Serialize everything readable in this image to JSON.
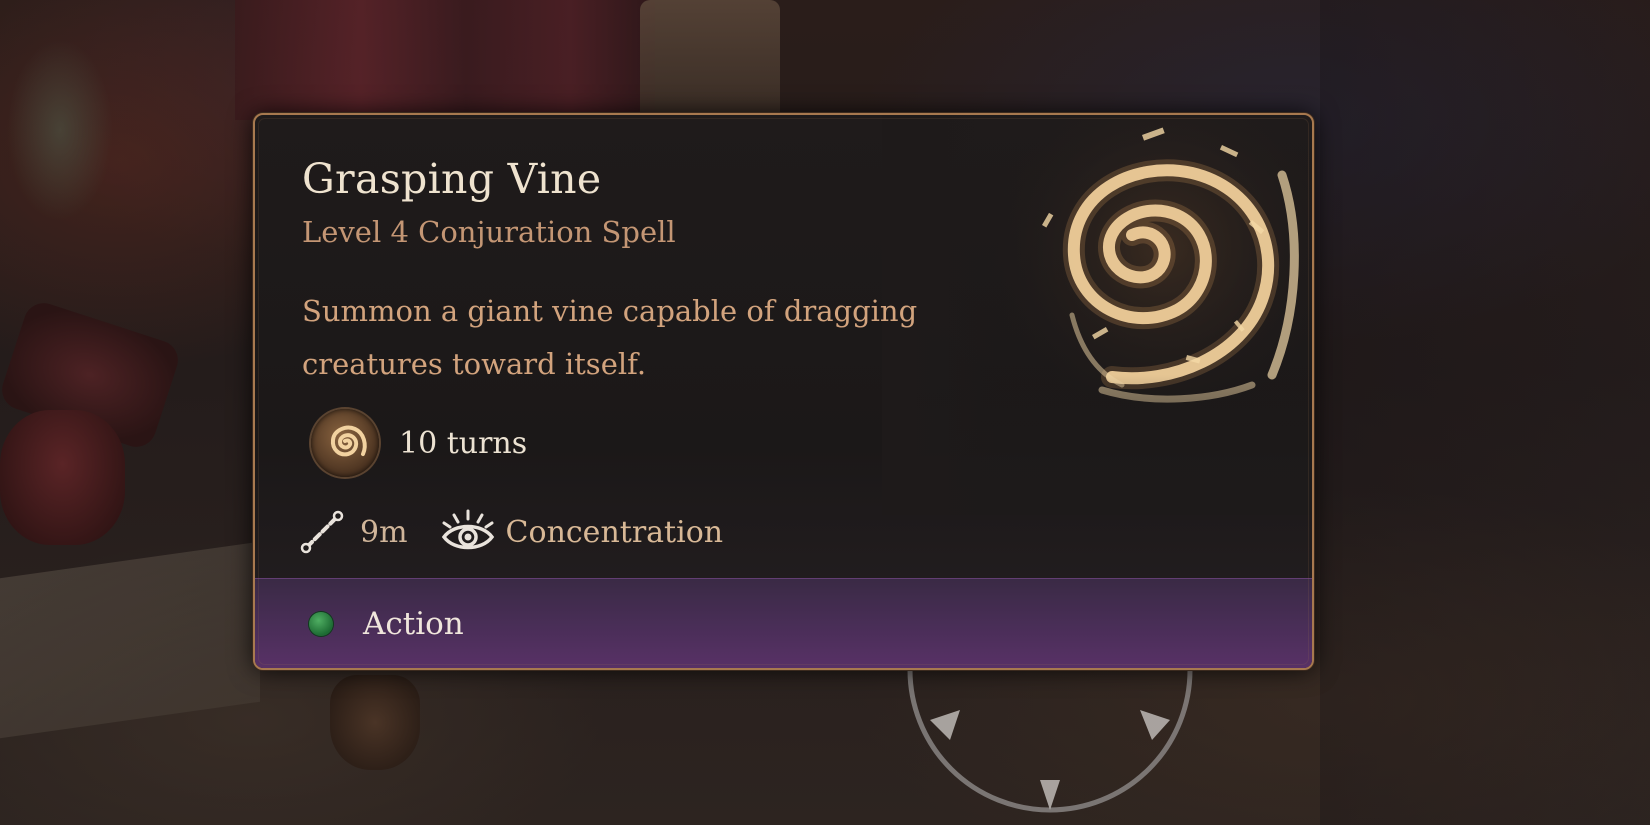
{
  "spell": {
    "name": "Grasping Vine",
    "subtitle": "Level 4 Conjuration Spell",
    "description": "Summon a giant vine capable of dragging creatures toward itself.",
    "duration": "10 turns",
    "range": "9m",
    "concentration": "Concentration",
    "cost": "Action"
  },
  "icons": {
    "spell_art": "spiral-vine-art",
    "duration": "spiral-badge-icon",
    "range": "range-line-icon",
    "concentration": "concentration-eye-icon",
    "cost": "green-dot-icon"
  },
  "colors": {
    "frame": "#a8794f",
    "title": "#efe3cf",
    "subtitle": "#c49674",
    "description": "#d2a37d",
    "action_bar": "#4a2e58",
    "action_dot": "#2e8a45"
  }
}
